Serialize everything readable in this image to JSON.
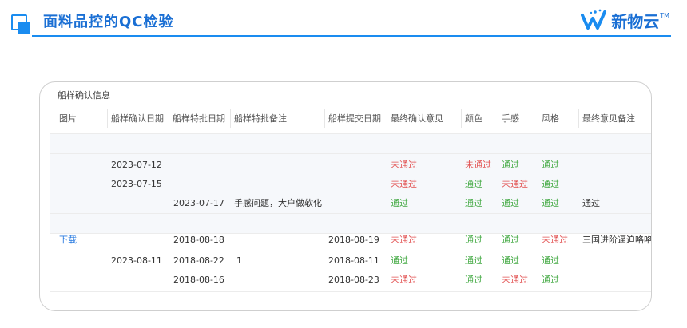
{
  "header": {
    "title": "面料品控的QC检验",
    "brand": "新物云",
    "brand_tm": "TM"
  },
  "panel": {
    "title": "船样确认信息",
    "columns": [
      "图片",
      "船样确认日期",
      "船样特批日期",
      "船样特批备注",
      "船样提交日期",
      "最终确认意见",
      "颜色",
      "手感",
      "风格",
      "最终意见备注"
    ],
    "groups": [
      {
        "rows": [
          {
            "image": "",
            "confirm_date": "2023-07-12",
            "special_date": "",
            "special_note": "",
            "submit_date": "",
            "final": "未通过",
            "color": "未通过",
            "hand": "通过",
            "style": "通过",
            "remark": ""
          },
          {
            "image": "",
            "confirm_date": "2023-07-15",
            "special_date": "",
            "special_note": "",
            "submit_date": "",
            "final": "未通过",
            "color": "通过",
            "hand": "未通过",
            "style": "通过",
            "remark": ""
          },
          {
            "image": "",
            "confirm_date": "",
            "special_date": "2023-07-17",
            "special_note": "手感问题，大户做软化",
            "submit_date": "",
            "final": "通过",
            "color": "通过",
            "hand": "通过",
            "style": "通过",
            "remark": "通过"
          }
        ]
      },
      {
        "rows": [
          {
            "image": "下载",
            "confirm_date": "",
            "special_date": "2018-08-18",
            "special_note": "",
            "submit_date": "2018-08-19",
            "final": "未通过",
            "color": "通过",
            "hand": "通过",
            "style": "未通过",
            "remark": "三国进阶逼迫咯咯"
          },
          {
            "image": "",
            "confirm_date": "2023-08-11",
            "special_date": "2018-08-22",
            "special_note": "1",
            "submit_date": "2018-08-11",
            "final": "通过",
            "color": "通过",
            "hand": "通过",
            "style": "通过",
            "remark": ""
          },
          {
            "image": "",
            "confirm_date": "",
            "special_date": "2018-08-16",
            "special_note": "",
            "submit_date": "2018-08-23",
            "final": "未通过",
            "color": "通过",
            "hand": "未通过",
            "style": "通过",
            "remark": ""
          }
        ]
      }
    ]
  },
  "colors": {
    "accent": "#1a8cf0",
    "fail": "#e25050",
    "pass": "#44aa44",
    "link": "#2a7be0"
  }
}
